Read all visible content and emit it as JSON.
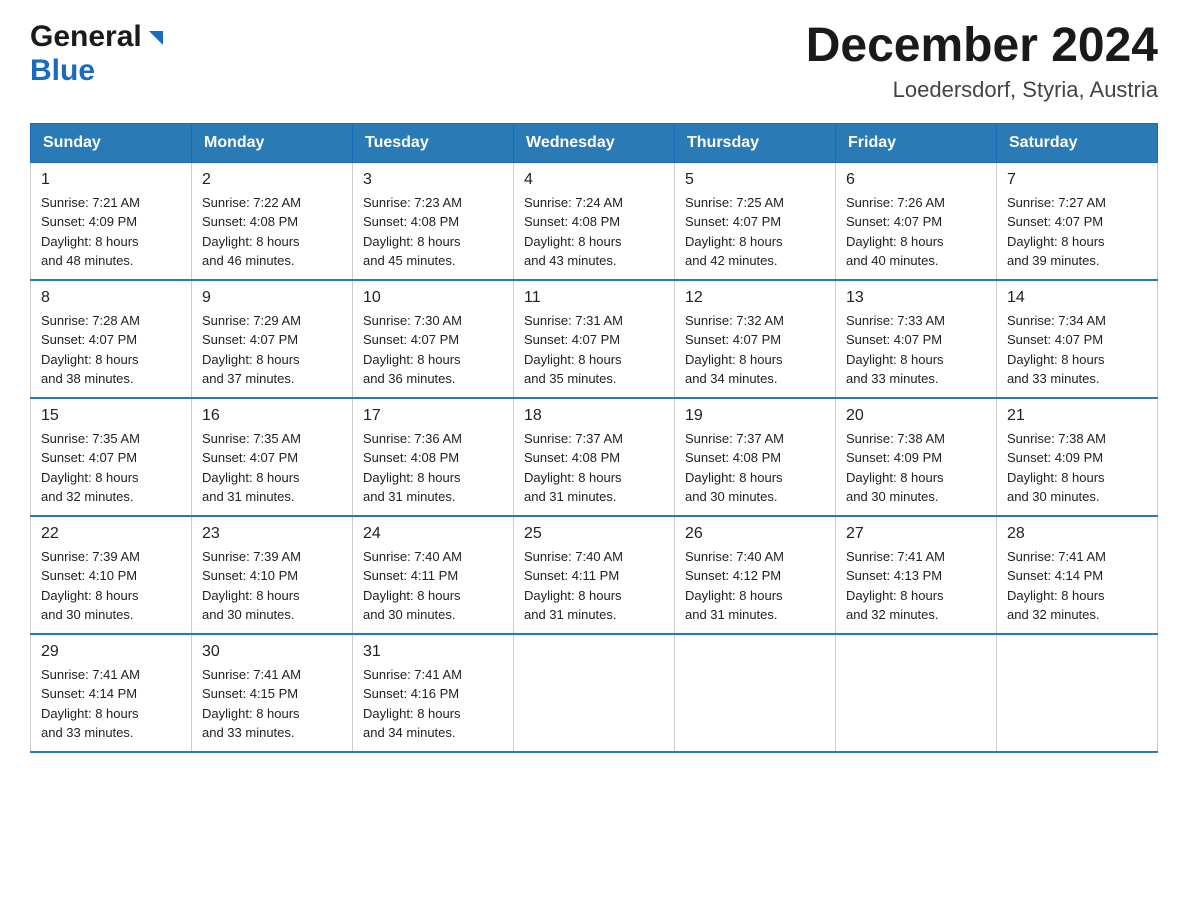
{
  "logo": {
    "line1": "General",
    "line2": "Blue"
  },
  "title": "December 2024",
  "location": "Loedersdorf, Styria, Austria",
  "days_of_week": [
    "Sunday",
    "Monday",
    "Tuesday",
    "Wednesday",
    "Thursday",
    "Friday",
    "Saturday"
  ],
  "weeks": [
    [
      {
        "num": "1",
        "sunrise": "7:21 AM",
        "sunset": "4:09 PM",
        "daylight": "8 hours and 48 minutes."
      },
      {
        "num": "2",
        "sunrise": "7:22 AM",
        "sunset": "4:08 PM",
        "daylight": "8 hours and 46 minutes."
      },
      {
        "num": "3",
        "sunrise": "7:23 AM",
        "sunset": "4:08 PM",
        "daylight": "8 hours and 45 minutes."
      },
      {
        "num": "4",
        "sunrise": "7:24 AM",
        "sunset": "4:08 PM",
        "daylight": "8 hours and 43 minutes."
      },
      {
        "num": "5",
        "sunrise": "7:25 AM",
        "sunset": "4:07 PM",
        "daylight": "8 hours and 42 minutes."
      },
      {
        "num": "6",
        "sunrise": "7:26 AM",
        "sunset": "4:07 PM",
        "daylight": "8 hours and 40 minutes."
      },
      {
        "num": "7",
        "sunrise": "7:27 AM",
        "sunset": "4:07 PM",
        "daylight": "8 hours and 39 minutes."
      }
    ],
    [
      {
        "num": "8",
        "sunrise": "7:28 AM",
        "sunset": "4:07 PM",
        "daylight": "8 hours and 38 minutes."
      },
      {
        "num": "9",
        "sunrise": "7:29 AM",
        "sunset": "4:07 PM",
        "daylight": "8 hours and 37 minutes."
      },
      {
        "num": "10",
        "sunrise": "7:30 AM",
        "sunset": "4:07 PM",
        "daylight": "8 hours and 36 minutes."
      },
      {
        "num": "11",
        "sunrise": "7:31 AM",
        "sunset": "4:07 PM",
        "daylight": "8 hours and 35 minutes."
      },
      {
        "num": "12",
        "sunrise": "7:32 AM",
        "sunset": "4:07 PM",
        "daylight": "8 hours and 34 minutes."
      },
      {
        "num": "13",
        "sunrise": "7:33 AM",
        "sunset": "4:07 PM",
        "daylight": "8 hours and 33 minutes."
      },
      {
        "num": "14",
        "sunrise": "7:34 AM",
        "sunset": "4:07 PM",
        "daylight": "8 hours and 33 minutes."
      }
    ],
    [
      {
        "num": "15",
        "sunrise": "7:35 AM",
        "sunset": "4:07 PM",
        "daylight": "8 hours and 32 minutes."
      },
      {
        "num": "16",
        "sunrise": "7:35 AM",
        "sunset": "4:07 PM",
        "daylight": "8 hours and 31 minutes."
      },
      {
        "num": "17",
        "sunrise": "7:36 AM",
        "sunset": "4:08 PM",
        "daylight": "8 hours and 31 minutes."
      },
      {
        "num": "18",
        "sunrise": "7:37 AM",
        "sunset": "4:08 PM",
        "daylight": "8 hours and 31 minutes."
      },
      {
        "num": "19",
        "sunrise": "7:37 AM",
        "sunset": "4:08 PM",
        "daylight": "8 hours and 30 minutes."
      },
      {
        "num": "20",
        "sunrise": "7:38 AM",
        "sunset": "4:09 PM",
        "daylight": "8 hours and 30 minutes."
      },
      {
        "num": "21",
        "sunrise": "7:38 AM",
        "sunset": "4:09 PM",
        "daylight": "8 hours and 30 minutes."
      }
    ],
    [
      {
        "num": "22",
        "sunrise": "7:39 AM",
        "sunset": "4:10 PM",
        "daylight": "8 hours and 30 minutes."
      },
      {
        "num": "23",
        "sunrise": "7:39 AM",
        "sunset": "4:10 PM",
        "daylight": "8 hours and 30 minutes."
      },
      {
        "num": "24",
        "sunrise": "7:40 AM",
        "sunset": "4:11 PM",
        "daylight": "8 hours and 30 minutes."
      },
      {
        "num": "25",
        "sunrise": "7:40 AM",
        "sunset": "4:11 PM",
        "daylight": "8 hours and 31 minutes."
      },
      {
        "num": "26",
        "sunrise": "7:40 AM",
        "sunset": "4:12 PM",
        "daylight": "8 hours and 31 minutes."
      },
      {
        "num": "27",
        "sunrise": "7:41 AM",
        "sunset": "4:13 PM",
        "daylight": "8 hours and 32 minutes."
      },
      {
        "num": "28",
        "sunrise": "7:41 AM",
        "sunset": "4:14 PM",
        "daylight": "8 hours and 32 minutes."
      }
    ],
    [
      {
        "num": "29",
        "sunrise": "7:41 AM",
        "sunset": "4:14 PM",
        "daylight": "8 hours and 33 minutes."
      },
      {
        "num": "30",
        "sunrise": "7:41 AM",
        "sunset": "4:15 PM",
        "daylight": "8 hours and 33 minutes."
      },
      {
        "num": "31",
        "sunrise": "7:41 AM",
        "sunset": "4:16 PM",
        "daylight": "8 hours and 34 minutes."
      },
      null,
      null,
      null,
      null
    ]
  ],
  "labels": {
    "sunrise": "Sunrise:",
    "sunset": "Sunset:",
    "daylight": "Daylight:"
  }
}
